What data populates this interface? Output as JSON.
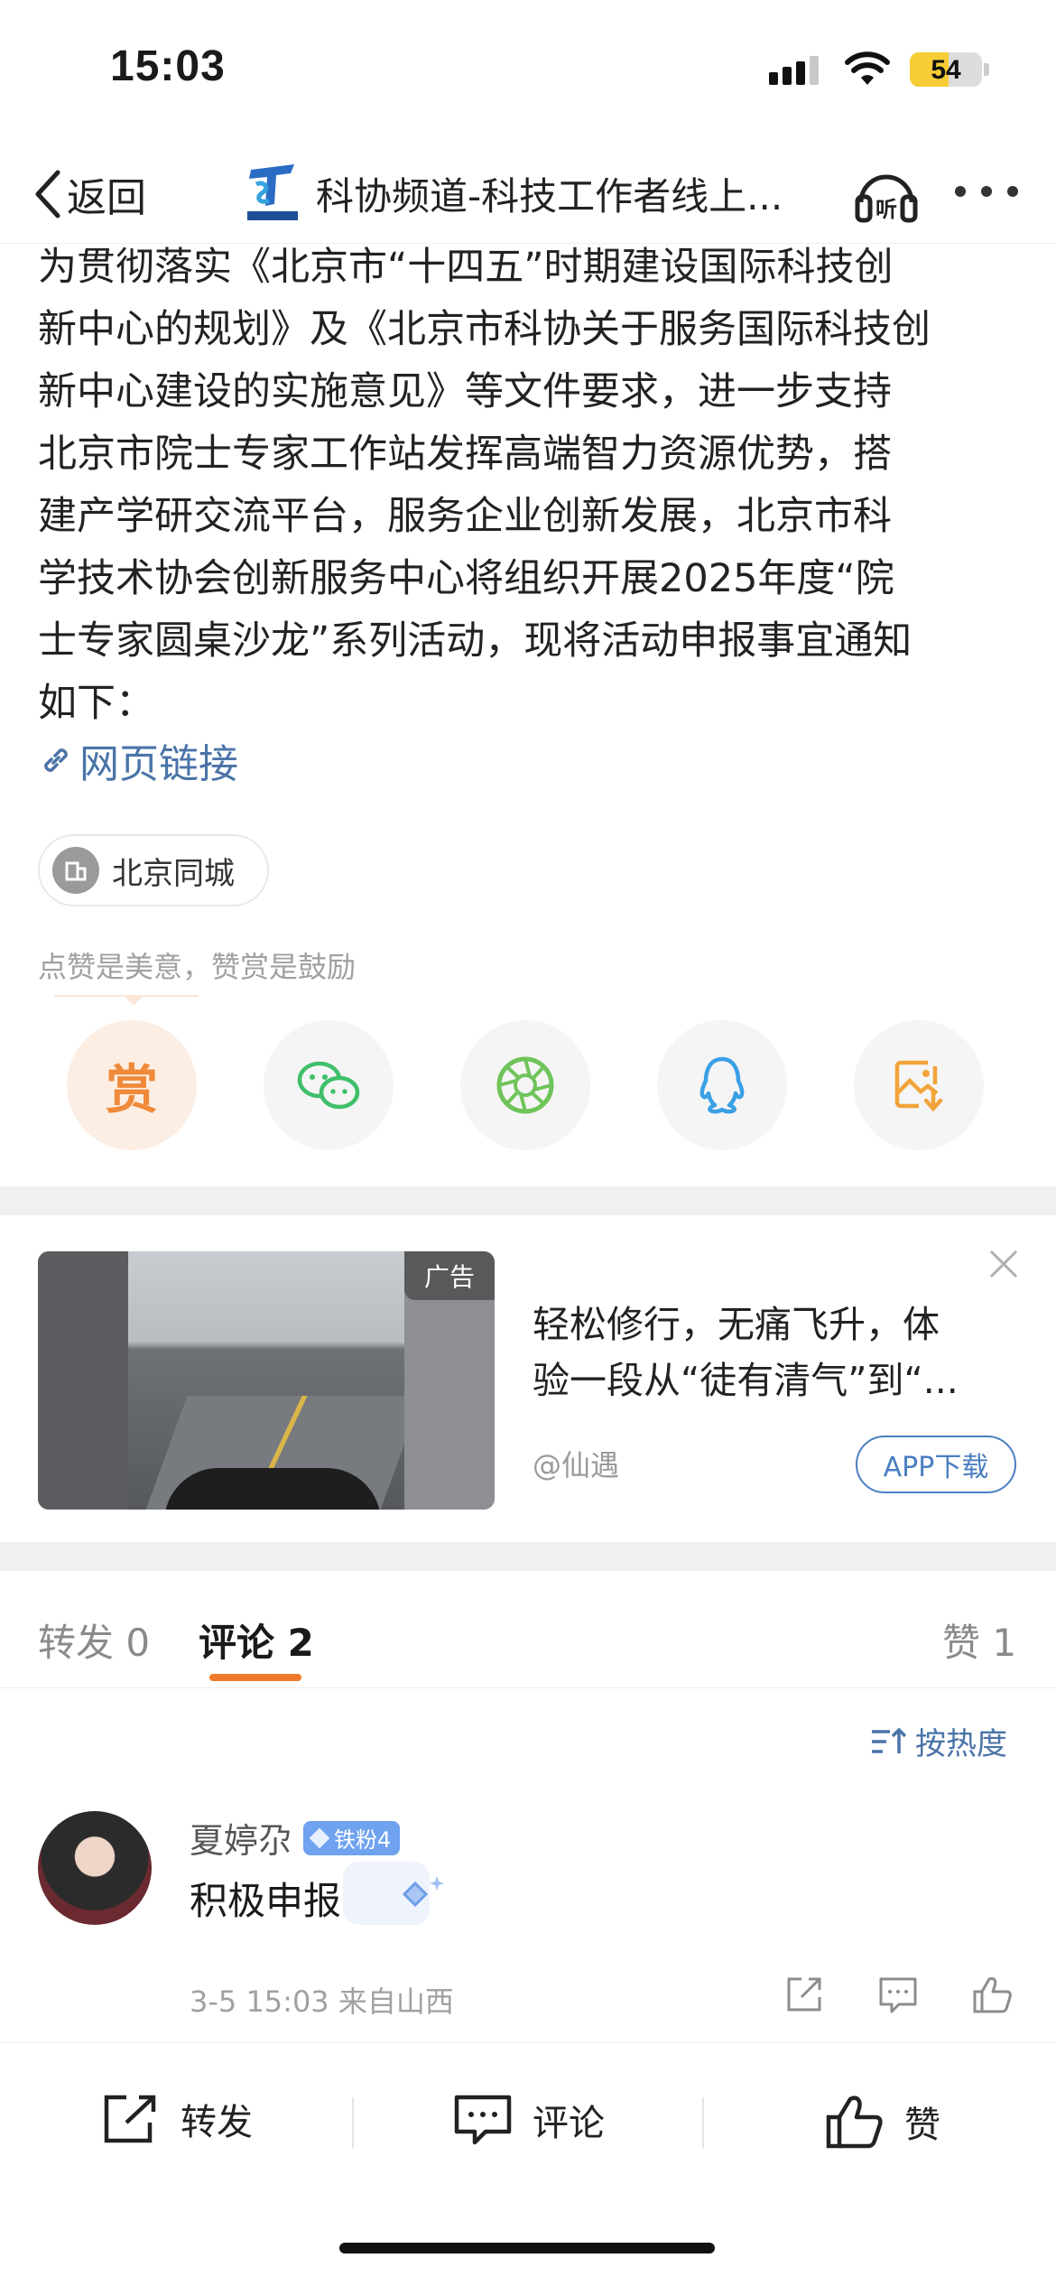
{
  "status": {
    "time": "15:03",
    "battery": "54"
  },
  "nav": {
    "back_label": "返回",
    "title": "科协频道-科技工作者线上...",
    "listen_label": "听"
  },
  "article": {
    "lines": [
      "为贯彻落实《北京市“十四五”时期建设国际科技创",
      "新中心的规划》及《北京市科协关于服务国际科技创",
      "新中心建设的实施意见》等文件要求，进一步支持",
      "北京市院士专家工作站发挥高端智力资源优势，搭",
      "建产学研交流平台，服务企业创新发展，北京市科",
      "学技术协会创新服务中心将组织开展2025年度“院",
      "士专家圆桌沙龙”系列活动，现将活动申报事宜通知",
      "如下："
    ],
    "link_label": "网页链接",
    "location": "北京同城"
  },
  "praise_text": "点赞是美意，赞赏是鼓励",
  "share": {
    "reward_label": "赏"
  },
  "ad": {
    "tag": "广告",
    "title_line1": "轻松修行，无痛飞升，体",
    "title_line2": "验一段从“徒有清气”到“...",
    "source": "@仙遇",
    "button": "APP下载"
  },
  "tabs": {
    "repost": "转发 0",
    "comments": "评论 2",
    "likes": "赞 1"
  },
  "sort_label": "按热度",
  "comment": {
    "username": "夏婷尕",
    "badge": "铁粉4",
    "text": "积极申报",
    "meta": "3-5 15:03 来自山西"
  },
  "bottom": {
    "repost": "转发",
    "comment": "评论",
    "like": "赞"
  },
  "colors": {
    "accent_orange": "#ef7b2a",
    "link_blue": "#4a74a8",
    "wechat_green": "#3fbf6a",
    "qq_blue": "#3aa0e6",
    "save_orange": "#f2a33a"
  }
}
